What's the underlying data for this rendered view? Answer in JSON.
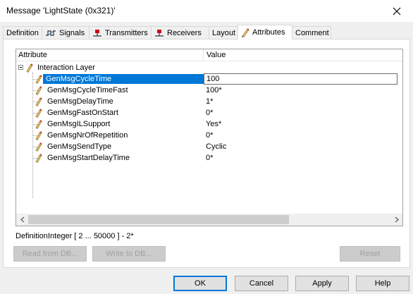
{
  "window": {
    "title": "Message 'LightState (0x321)'"
  },
  "tabs": [
    {
      "label": "Definition",
      "icon": ""
    },
    {
      "label": "Signals",
      "icon": "signal-icon"
    },
    {
      "label": "Transmitters",
      "icon": "node-icon"
    },
    {
      "label": "Receivers",
      "icon": "node-icon"
    },
    {
      "label": "Layout",
      "icon": ""
    },
    {
      "label": "Attributes",
      "icon": "pencil-icon"
    },
    {
      "label": "Comment",
      "icon": ""
    }
  ],
  "active_tab": "Attributes",
  "grid": {
    "columns": [
      "Attribute",
      "Value"
    ],
    "group": "Interaction Layer",
    "rows": [
      {
        "name": "GenMsgCycleTime",
        "value": "100"
      },
      {
        "name": "GenMsgCycleTimeFast",
        "value": "100*"
      },
      {
        "name": "GenMsgDelayTime",
        "value": "1*"
      },
      {
        "name": "GenMsgFastOnStart",
        "value": "0*"
      },
      {
        "name": "GenMsgILSupport",
        "value": "Yes*"
      },
      {
        "name": "GenMsgNrOfRepetition",
        "value": "0*"
      },
      {
        "name": "GenMsgSendType",
        "value": "Cyclic"
      },
      {
        "name": "GenMsgStartDelayTime",
        "value": "0*"
      }
    ],
    "selected_row": "GenMsgCycleTime"
  },
  "definition": {
    "label": "Definition:",
    "value": "Integer [ 2 ... 50000 ] - 2*"
  },
  "panel_buttons": {
    "read": "Read from DB...",
    "write": "Write to DB...",
    "reset": "Reset"
  },
  "footer": {
    "ok": "OK",
    "cancel": "Cancel",
    "apply": "Apply",
    "help": "Help"
  },
  "colors": {
    "selection": "#0078d7",
    "pencil": "#c0392b",
    "node": "#d0021b"
  }
}
